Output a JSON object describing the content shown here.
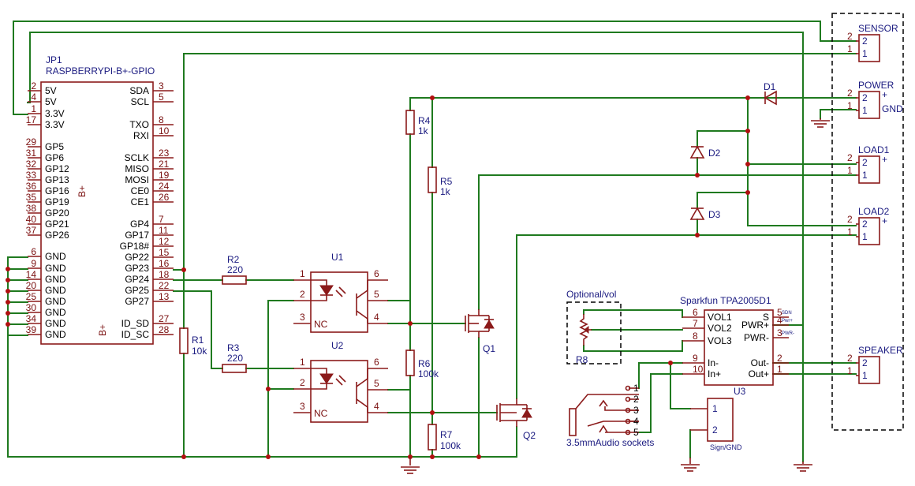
{
  "header": {
    "jp1_ref": "JP1",
    "jp1_value": "RASPBERRYPI-B+-GPIO",
    "jp1_side": "B+"
  },
  "jp1": {
    "left_pins": [
      {
        "num": "2",
        "name": "5V"
      },
      {
        "num": "4",
        "name": "5V"
      },
      {
        "num": "1",
        "name": "3.3V"
      },
      {
        "num": "17",
        "name": "3.3V"
      },
      {
        "num": "29",
        "name": "GP5"
      },
      {
        "num": "31",
        "name": "GP6"
      },
      {
        "num": "32",
        "name": "GP12"
      },
      {
        "num": "33",
        "name": "GP13"
      },
      {
        "num": "36",
        "name": "GP16"
      },
      {
        "num": "35",
        "name": "GP19"
      },
      {
        "num": "38",
        "name": "GP20"
      },
      {
        "num": "40",
        "name": "GP21"
      },
      {
        "num": "37",
        "name": "GP26"
      },
      {
        "num": "6",
        "name": "GND"
      },
      {
        "num": "9",
        "name": "GND"
      },
      {
        "num": "14",
        "name": "GND"
      },
      {
        "num": "20",
        "name": "GND"
      },
      {
        "num": "25",
        "name": "GND"
      },
      {
        "num": "30",
        "name": "GND"
      },
      {
        "num": "34",
        "name": "GND"
      },
      {
        "num": "39",
        "name": "GND"
      }
    ],
    "right_pins": [
      {
        "num": "3",
        "name": "SDA"
      },
      {
        "num": "5",
        "name": "SCL"
      },
      {
        "num": "8",
        "name": "TXO"
      },
      {
        "num": "10",
        "name": "RXI"
      },
      {
        "num": "23",
        "name": "SCLK"
      },
      {
        "num": "21",
        "name": "MISO"
      },
      {
        "num": "19",
        "name": "MOSI"
      },
      {
        "num": "24",
        "name": "CE0"
      },
      {
        "num": "26",
        "name": "CE1"
      },
      {
        "num": "7",
        "name": "GP4"
      },
      {
        "num": "11",
        "name": "GP17"
      },
      {
        "num": "12",
        "name": "GP18#"
      },
      {
        "num": "15",
        "name": "GP22"
      },
      {
        "num": "16",
        "name": "GP23"
      },
      {
        "num": "18",
        "name": "GP24"
      },
      {
        "num": "22",
        "name": "GP25"
      },
      {
        "num": "13",
        "name": "GP27"
      },
      {
        "num": "27",
        "name": "ID_SD"
      },
      {
        "num": "28",
        "name": "ID_SC"
      }
    ],
    "inner_mark": "B+"
  },
  "components": {
    "r1": {
      "ref": "R1",
      "value": "10k"
    },
    "r2": {
      "ref": "R2",
      "value": "220"
    },
    "r3": {
      "ref": "R3",
      "value": "220"
    },
    "r4": {
      "ref": "R4",
      "value": "1k"
    },
    "r5": {
      "ref": "R5",
      "value": "1k"
    },
    "r6": {
      "ref": "R6",
      "value": "100k"
    },
    "r7": {
      "ref": "R7",
      "value": "100k"
    },
    "r8": {
      "ref": "R8"
    },
    "u1": {
      "ref": "U1",
      "pins": [
        "1",
        "2",
        "3",
        "6",
        "5",
        "4"
      ],
      "nc": "NC"
    },
    "u2": {
      "ref": "U2",
      "pins": [
        "1",
        "2",
        "3",
        "6",
        "5",
        "4"
      ],
      "nc": "NC"
    },
    "q1": {
      "ref": "Q1"
    },
    "q2": {
      "ref": "Q2"
    },
    "d1": {
      "ref": "D1"
    },
    "d2": {
      "ref": "D2"
    },
    "d3": {
      "ref": "D3"
    },
    "optional": {
      "label": "Optional/vol"
    },
    "u3": {
      "ref": "U3",
      "title": "Sparkfun TPA2005D1",
      "left_pins": [
        {
          "num": "6",
          "name": "VOL1"
        },
        {
          "num": "7",
          "name": "VOL2"
        },
        {
          "num": "8",
          "name": "VOL3"
        },
        {
          "num": "9",
          "name": "In-"
        },
        {
          "num": "10",
          "name": "In+"
        }
      ],
      "right_pins": [
        {
          "num": "5",
          "name": "S",
          "sub": "SDN"
        },
        {
          "num": "4",
          "name": "PWR+",
          "sub": "Pwr+"
        },
        {
          "num": "3",
          "name": "PWR-",
          "sub": "PWR-"
        },
        {
          "num": "2",
          "name": "Out-"
        },
        {
          "num": "1",
          "name": "Out+"
        }
      ]
    },
    "audio": {
      "label": "3.5mmAudio sockets",
      "pins": [
        "1",
        "2",
        "3",
        "4",
        "5"
      ]
    },
    "sign_gnd": {
      "label": "Sign/GND",
      "pins": [
        "1",
        "2"
      ]
    }
  },
  "connectors": [
    {
      "name": "SENSOR",
      "pins": [
        "2",
        "1"
      ],
      "marks": []
    },
    {
      "name": "POWER",
      "pins": [
        "2",
        "1"
      ],
      "marks": [
        "+",
        "GND"
      ]
    },
    {
      "name": "LOAD1",
      "pins": [
        "2",
        "1"
      ],
      "marks": [
        "+"
      ]
    },
    {
      "name": "LOAD2",
      "pins": [
        "2",
        "1"
      ],
      "marks": [
        "+"
      ]
    },
    {
      "name": "SPEAKER",
      "pins": [
        "2",
        "1"
      ],
      "marks": []
    }
  ],
  "connector_pin_labels": [
    "2",
    "1",
    "2",
    "1",
    "2",
    "1",
    "2",
    "1",
    "2",
    "1"
  ]
}
